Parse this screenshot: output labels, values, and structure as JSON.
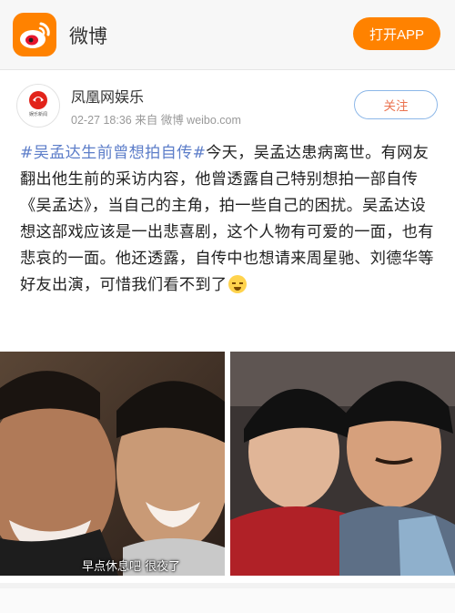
{
  "header": {
    "app_name": "微博",
    "open_app_label": "打开APP"
  },
  "post": {
    "author": "凤凰网娱乐",
    "avatar_text": "娱乐新闻",
    "timestamp": "02-27 18:36",
    "source": "来自 微博 weibo.com",
    "follow_label": "关注",
    "hashtag": "#吴孟达生前曾想拍自传#",
    "body": "今天，吴孟达患病离世。有网友翻出他生前的采访内容，他曾透露自己特别想拍一部自传《吴孟达》，当自己的主角，拍一些自己的困扰。吴孟达设想这部戏应该是一出悲喜剧，这个人物有可爱的一面，也有悲哀的一面。他还透露，自传中也想请来周星驰、刘德华等好友出演，可惜我们看不到了",
    "emoji": "crying-emoji"
  },
  "photos": {
    "left_caption": "早点休息吧 很夜了"
  },
  "colors": {
    "brand_orange": "#ff8200",
    "link_blue": "#5d7ec9",
    "hashtag_orange": "#eb7350"
  }
}
